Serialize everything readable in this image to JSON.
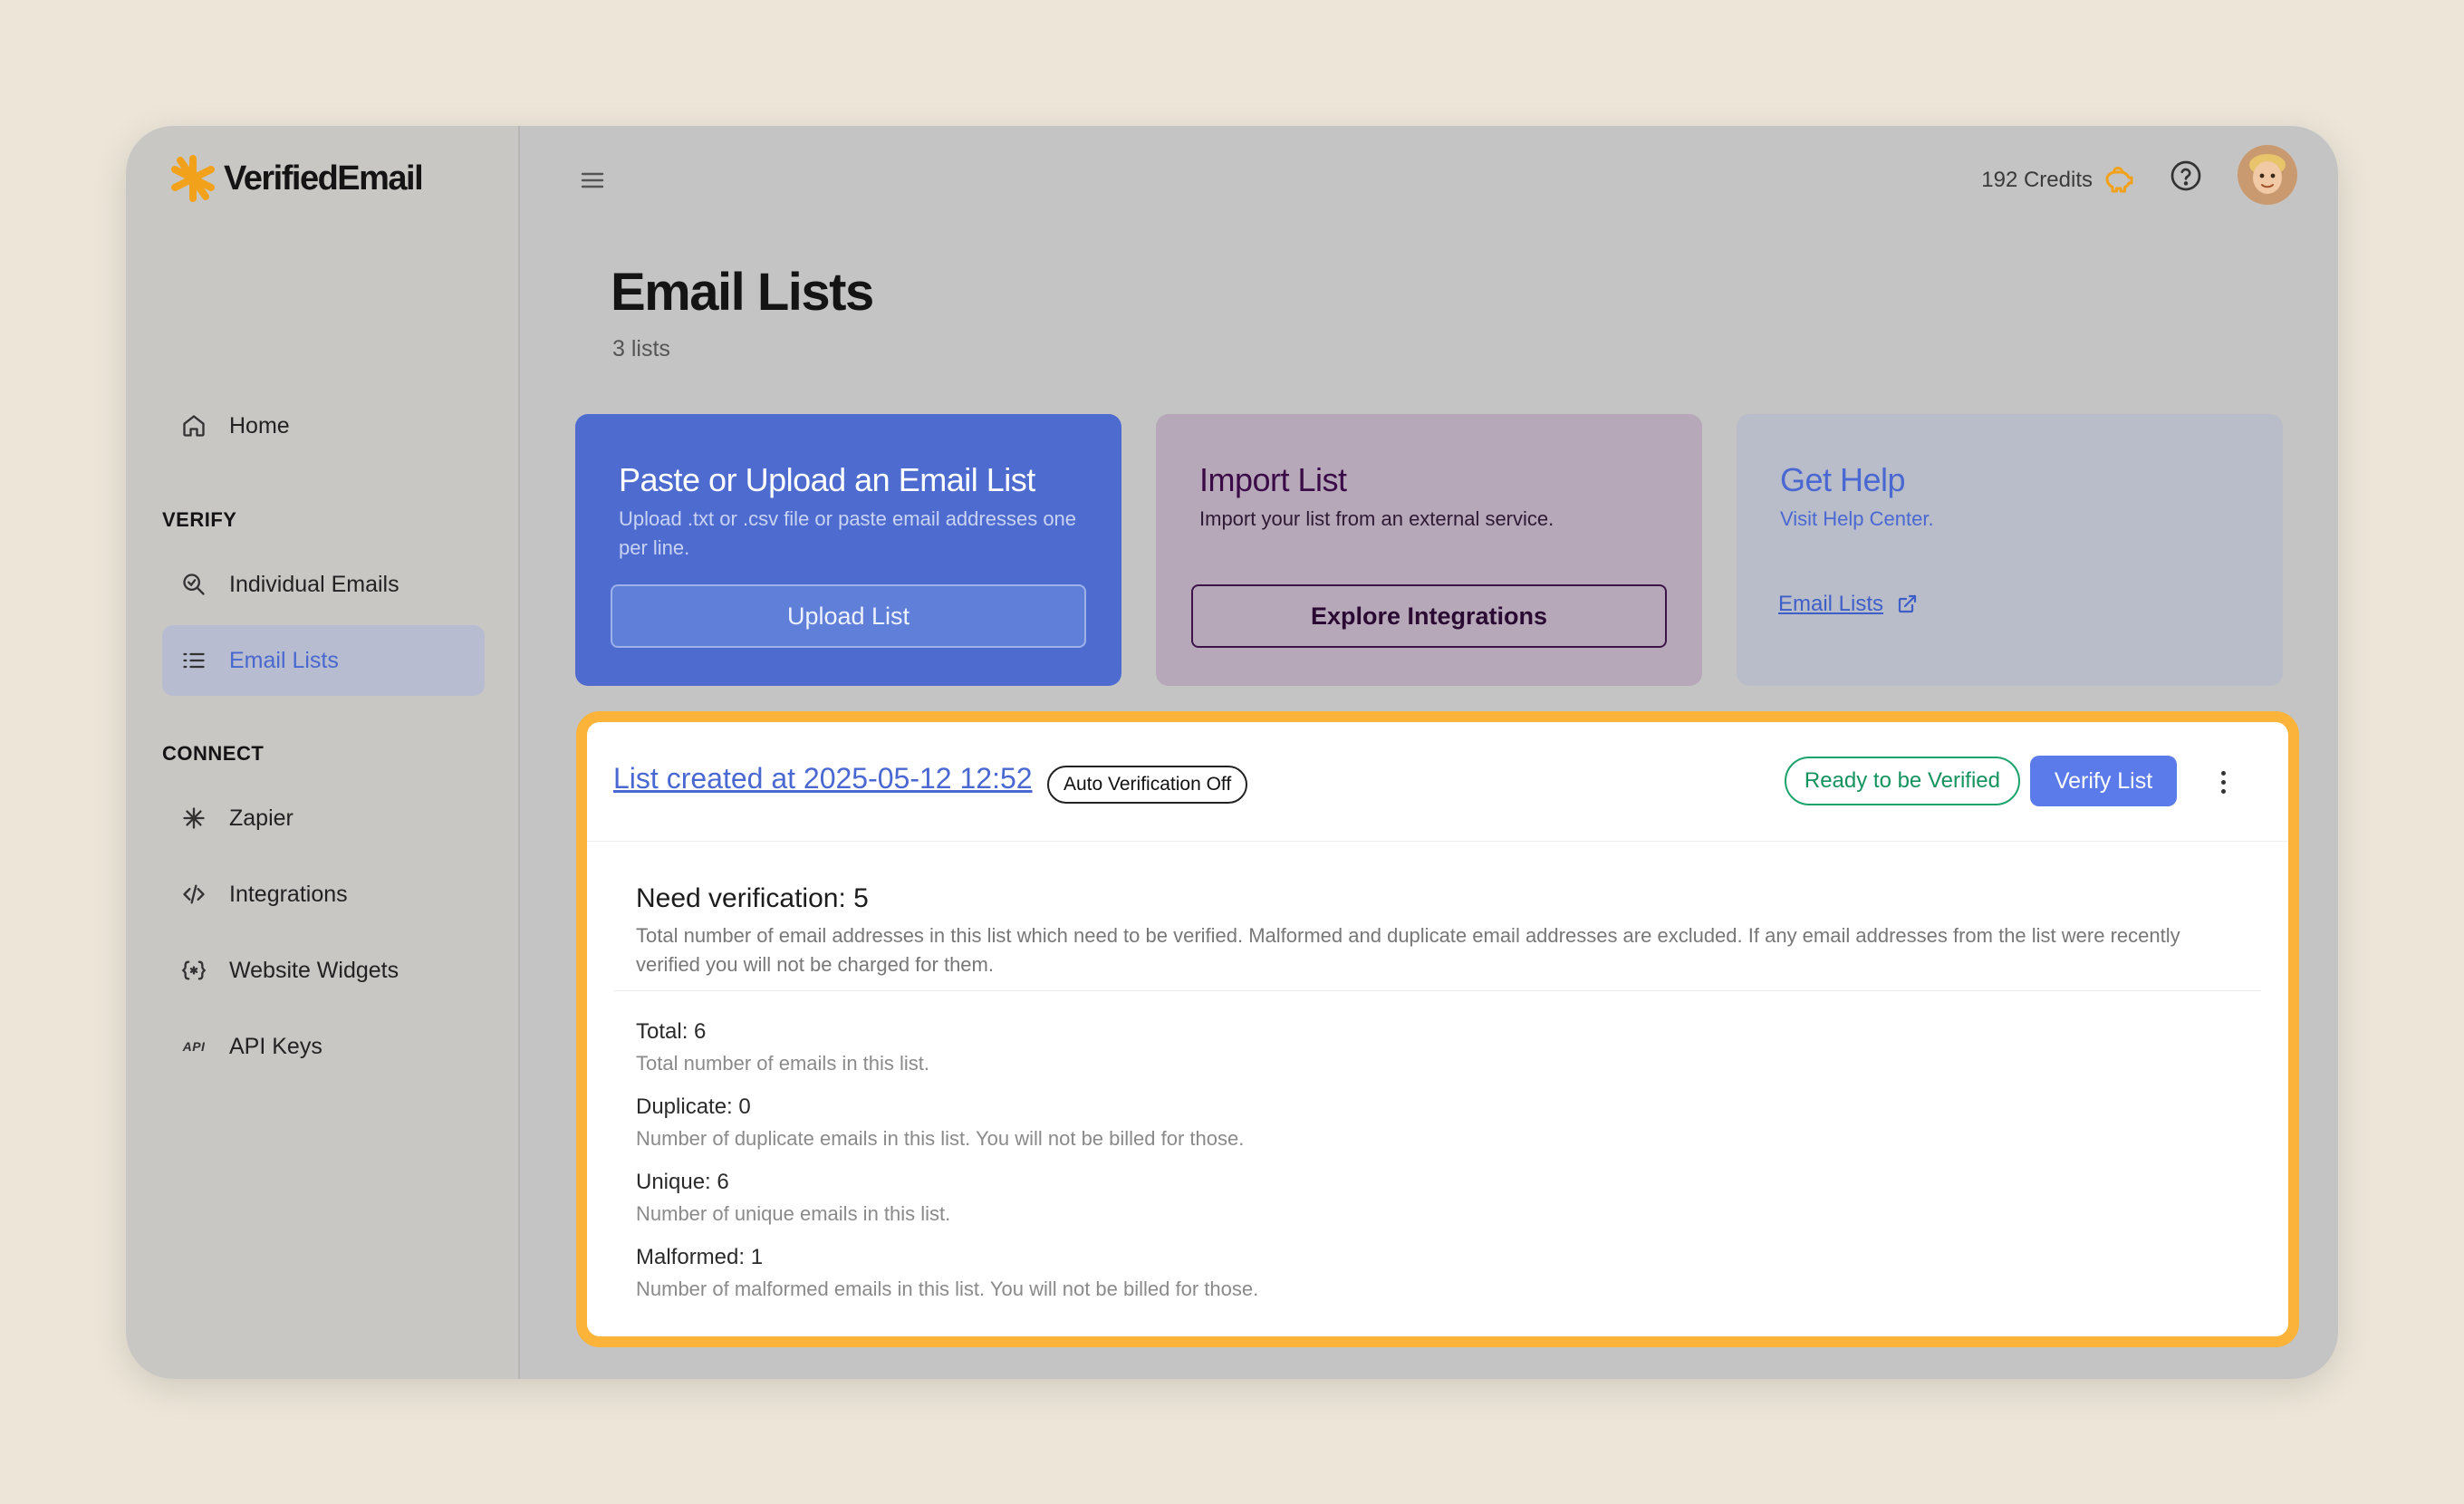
{
  "brand": {
    "name": "VerifiedEmail",
    "accent": "#f2a21a"
  },
  "sidebar": {
    "home": "Home",
    "verify_section": "VERIFY",
    "individual_emails": "Individual Emails",
    "email_lists": "Email Lists",
    "connect_section": "CONNECT",
    "zapier": "Zapier",
    "integrations": "Integrations",
    "website_widgets": "Website Widgets",
    "api_keys": "API Keys",
    "api_icon_text": "API"
  },
  "topbar": {
    "credits": "192 Credits"
  },
  "page": {
    "title": "Email Lists",
    "subtitle": "3 lists"
  },
  "cards": {
    "upload": {
      "title": "Paste or Upload an Email List",
      "desc": "Upload .txt or .csv file or paste email addresses one per line.",
      "button": "Upload List"
    },
    "import": {
      "title": "Import List",
      "desc": "Import your list from an external service.",
      "button": "Explore Integrations"
    },
    "help": {
      "title": "Get Help",
      "desc": "Visit Help Center.",
      "link": "Email Lists"
    }
  },
  "list": {
    "title": "List created at 2025-05-12 12:52",
    "auto_badge": "Auto Verification Off",
    "status": "Ready to be Verified",
    "verify_button": "Verify List",
    "need_title": "Need verification: 5",
    "need_desc": "Total number of email addresses in this list which need to be verified. Malformed and duplicate email addresses are excluded. If any email addresses from the list were recently verified you will not be charged for them.",
    "stats": [
      {
        "label": "Total: 6",
        "desc": "Total number of emails in this list."
      },
      {
        "label": "Duplicate: 0",
        "desc": "Number of duplicate emails in this list. You will not be billed for those."
      },
      {
        "label": "Unique: 6",
        "desc": "Number of unique emails in this list."
      },
      {
        "label": "Malformed: 1",
        "desc": "Number of malformed emails in this list. You will not be billed for those."
      }
    ]
  }
}
